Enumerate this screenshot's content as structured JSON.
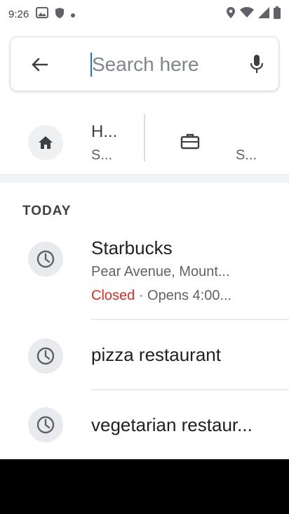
{
  "status_bar": {
    "time": "9:26",
    "icons": [
      "image-icon",
      "shield-icon",
      "dot-icon",
      "location-icon",
      "wifi-icon",
      "signal-icon",
      "battery-icon"
    ]
  },
  "search": {
    "placeholder": "Search here",
    "value": ""
  },
  "shortcuts": {
    "home": {
      "title": "H...",
      "subtitle": "S..."
    },
    "work": {
      "subtitle": "S..."
    }
  },
  "history": {
    "section_label": "TODAY",
    "items": [
      {
        "title": "Starbucks",
        "address": "Pear Avenue, Mount...",
        "status_closed": "Closed",
        "status_rest": " · Opens 4:00..."
      },
      {
        "title": "pizza restaurant"
      },
      {
        "title": "vegetarian restaur..."
      }
    ]
  },
  "colors": {
    "accent": "#1a73e8",
    "closed": "#d93025",
    "icon_gray": "#5f6368"
  }
}
